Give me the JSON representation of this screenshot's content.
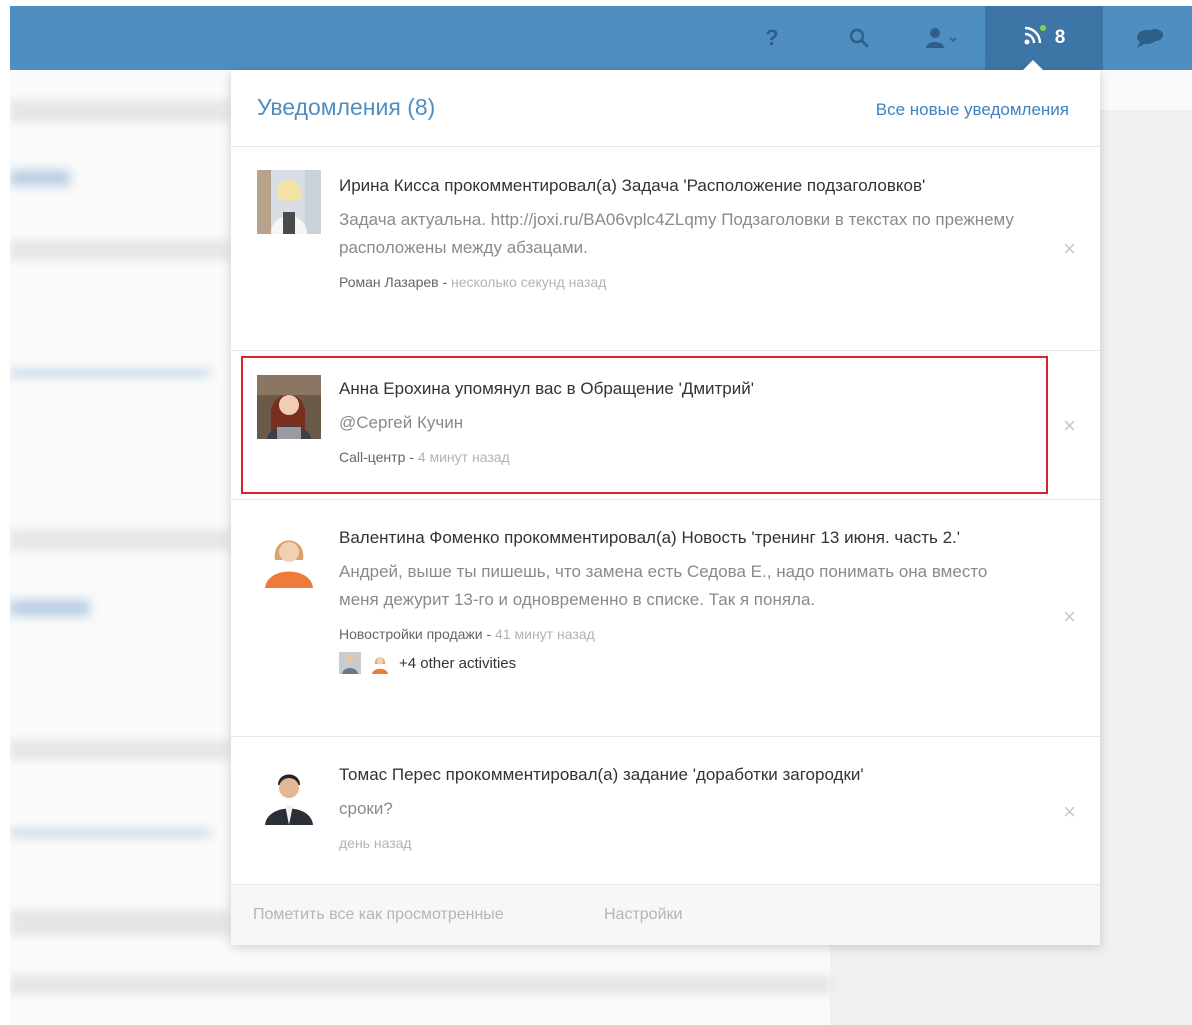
{
  "topbar": {
    "help_label": "?",
    "notif_count": "8"
  },
  "panel": {
    "title": "Уведомления (8)",
    "all_new_link": "Все новые уведомления",
    "footer": {
      "mark_all": "Пометить все как просмотренные",
      "settings": "Настройки"
    }
  },
  "notifications": [
    {
      "title": "Ирина Кисса прокомментировал(а) Задача 'Расположение подзаголовков'",
      "body": "Задача актуальна. http://joxi.ru/BA06vplc4ZLqmy Подзаголовки в текстах по прежнему расположены между абзацами.",
      "source": "Роман Лазарев",
      "time": "несколько секунд назад",
      "close": "×"
    },
    {
      "title": "Анна Ерохина упомянул вас в Обращение 'Дмитрий'",
      "body": "@Сергей Кучин",
      "source": "Call-центр",
      "time": "4 минут назад",
      "close": "×"
    },
    {
      "title": "Валентина Фоменко прокомментировал(а) Новость 'тренинг 13 июня. часть 2.'",
      "body": "Андрей, выше ты пишешь, что замена есть Седова Е., надо понимать она вместо меня дежурит 13-го и одновременно в списке. Так я поняла.",
      "source": "Новостройки продажи",
      "time": "41 минут назад",
      "activities": "+4 other activities",
      "close": "×"
    },
    {
      "title": "Томас Перес прокомментировал(а) задание 'доработки загородки'",
      "body": "сроки?",
      "time": "день назад",
      "close": "×"
    }
  ],
  "colors": {
    "topbar": "#4f8ec0",
    "topbar_active": "#3d76a6",
    "link": "#3d82c0",
    "highlight": "#d9232d"
  }
}
